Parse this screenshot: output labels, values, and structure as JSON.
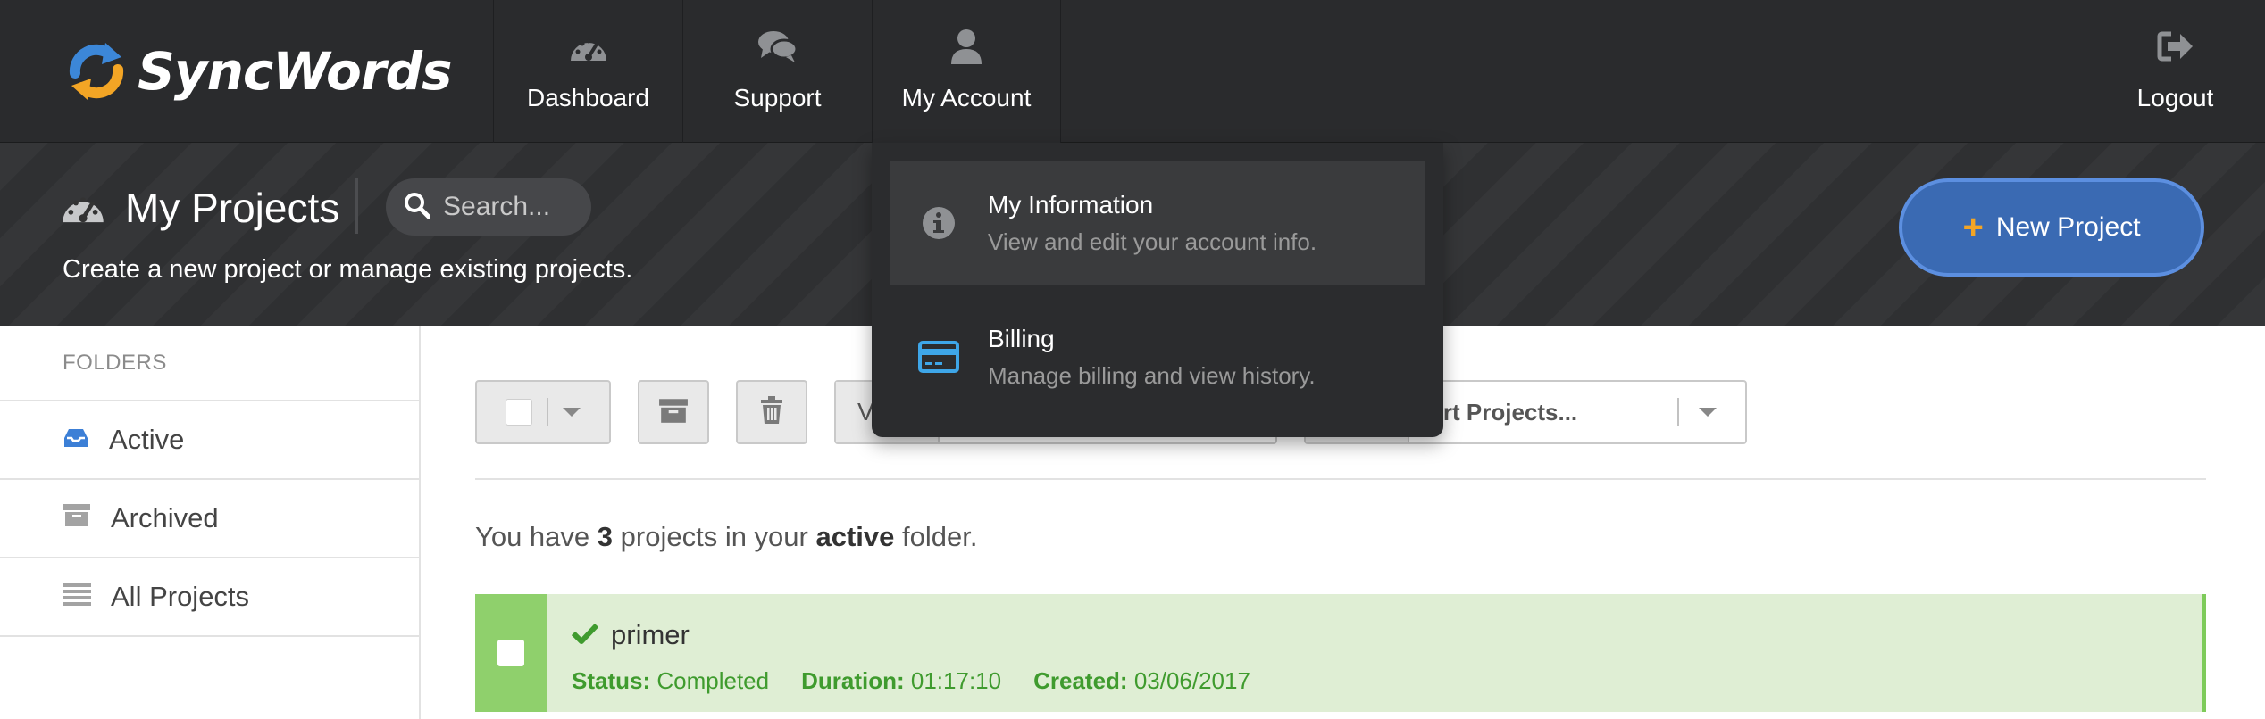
{
  "brand": {
    "name": "SyncWords"
  },
  "nav": {
    "tabs": [
      {
        "label": "Dashboard",
        "icon": "speedometer-icon"
      },
      {
        "label": "Support",
        "icon": "chat-bubbles-icon"
      },
      {
        "label": "My Account",
        "icon": "user-icon"
      }
    ],
    "logout": {
      "label": "Logout",
      "icon": "logout-icon"
    }
  },
  "header": {
    "title": "My Projects",
    "search_placeholder": "Search...",
    "subtitle": "Create a new project or manage existing projects.",
    "new_project_label": "New Project"
  },
  "account_menu": {
    "items": [
      {
        "title": "My Information",
        "subtitle": "View and edit your account info.",
        "icon": "info-icon"
      },
      {
        "title": "Billing",
        "subtitle": "Manage billing and view history.",
        "icon": "credit-card-icon"
      }
    ]
  },
  "sidebar": {
    "heading": "FOLDERS",
    "items": [
      {
        "label": "Active",
        "icon": "inbox-icon"
      },
      {
        "label": "Archived",
        "icon": "archive-box-icon"
      },
      {
        "label": "All Projects",
        "icon": "list-icon"
      }
    ]
  },
  "toolbar": {
    "view_prefix": "V",
    "sort_text": "ort Projects..."
  },
  "summary": {
    "prefix": "You have",
    "count": "3",
    "middle": "projects in your",
    "folder": "active",
    "suffix": "folder."
  },
  "projects": [
    {
      "name": "primer",
      "status_label": "Status:",
      "status": "Completed",
      "duration_label": "Duration:",
      "duration": "01:17:10",
      "created_label": "Created:",
      "created": "03/06/2017"
    }
  ],
  "colors": {
    "nav_bg": "#2a2b2d",
    "accent_blue": "#3a6ab3",
    "accent_orange": "#f3a525",
    "success_green": "#3f9b2e",
    "row_bg": "#dfeed4"
  }
}
